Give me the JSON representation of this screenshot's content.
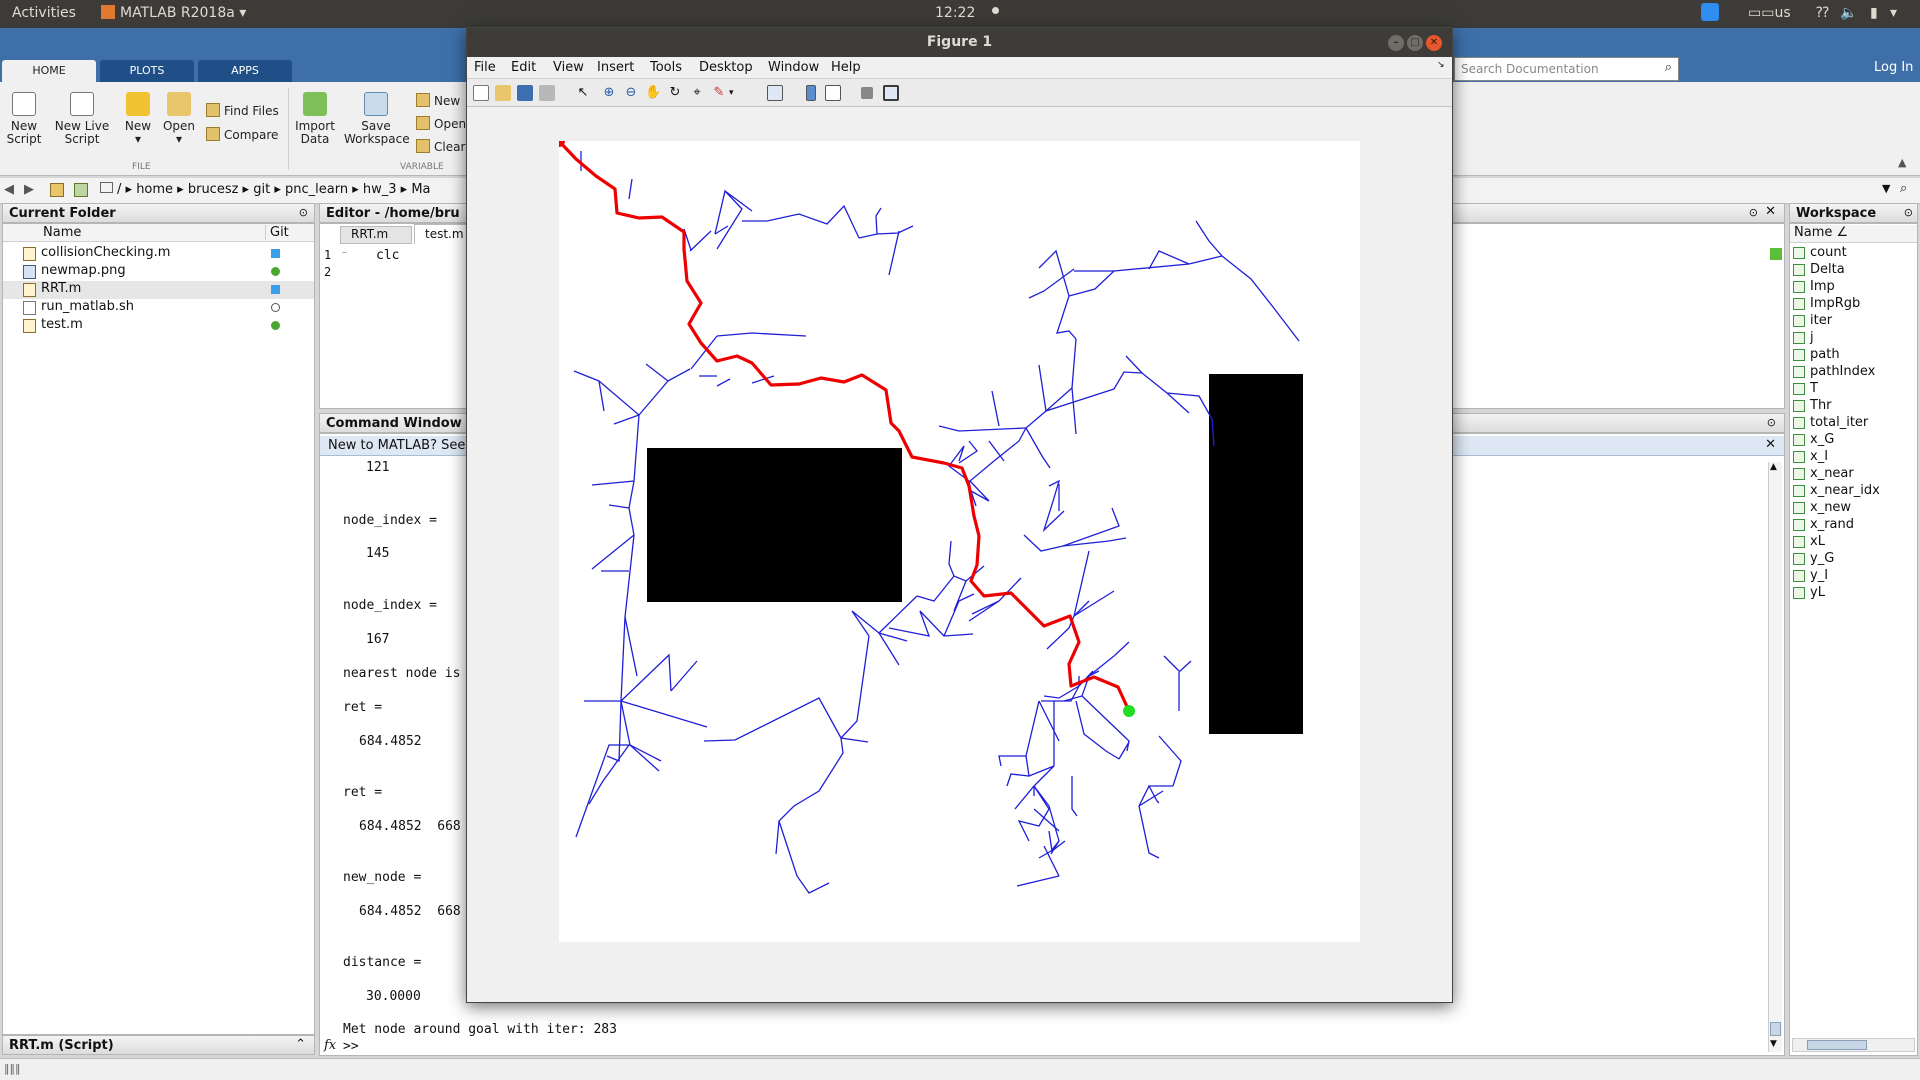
{
  "topbar": {
    "activities": "Activities",
    "app": "MATLAB R2018a",
    "time": "12:22",
    "lang": "us"
  },
  "ribbon": {
    "tabs": [
      "HOME",
      "PLOTS",
      "APPS"
    ],
    "buttons": {
      "new_script": "New Script",
      "new_live_script": "New Live Script",
      "new": "New",
      "open": "Open",
      "find_files": "Find Files",
      "compare": "Compare",
      "import_data": "Import Data",
      "save_workspace": "Save Workspace",
      "new_var": "New",
      "open_var": "Open",
      "clear": "Clear"
    },
    "sections": {
      "file": "FILE",
      "variable": "VARIABLE"
    },
    "search_placeholder": "Search Documentation",
    "login": "Log In"
  },
  "address": {
    "path": [
      "/",
      "home",
      "brucesz",
      "git",
      "pnc_learn",
      "hw_3",
      "Ma"
    ]
  },
  "current_folder": {
    "title": "Current Folder",
    "col_name": "Name",
    "col_git": "Git",
    "files": [
      {
        "name": "collisionChecking.m",
        "git": "#3a9ee8"
      },
      {
        "name": "newmap.png",
        "git": "#4aa832"
      },
      {
        "name": "RRT.m",
        "git": "#3a9ee8"
      },
      {
        "name": "run_matlab.sh",
        "git": "none"
      },
      {
        "name": "test.m",
        "git": "#4aa832"
      }
    ],
    "status": "RRT.m  (Script)"
  },
  "editor": {
    "title": "Editor - /home/bru",
    "tabs": [
      "RRT.m",
      "test.m"
    ],
    "line_numbers": [
      "1",
      "2"
    ],
    "code": "clc"
  },
  "command_window": {
    "title": "Command Window",
    "banner": "New to MATLAB? See r",
    "lines": [
      "121",
      "node_index =",
      "145",
      "node_index =",
      "167",
      "nearest node is",
      "ret =",
      "684.4852",
      "ret =",
      "684.4852  668",
      "new_node =",
      "684.4852  668",
      "distance =",
      "30.0000",
      "Met node around goal with iter: 283"
    ],
    "prompt": ">>"
  },
  "workspace": {
    "title": "Workspace",
    "col_name": "Name",
    "vars": [
      "count",
      "Delta",
      "Imp",
      "ImpRgb",
      "iter",
      "j",
      "path",
      "pathIndex",
      "T",
      "Thr",
      "total_iter",
      "x_G",
      "x_I",
      "x_near",
      "x_near_idx",
      "x_new",
      "x_rand",
      "xL",
      "y_G",
      "y_I",
      "yL"
    ]
  },
  "figure": {
    "title": "Figure 1",
    "menu": [
      "File",
      "Edit",
      "View",
      "Insert",
      "Tools",
      "Desktop",
      "Window",
      "Help"
    ],
    "colors": {
      "tree": "#1f1fd8",
      "path": "#ee0000",
      "start": "#ee0000",
      "goal": "#22dd22",
      "obstacle": "#000000"
    }
  }
}
